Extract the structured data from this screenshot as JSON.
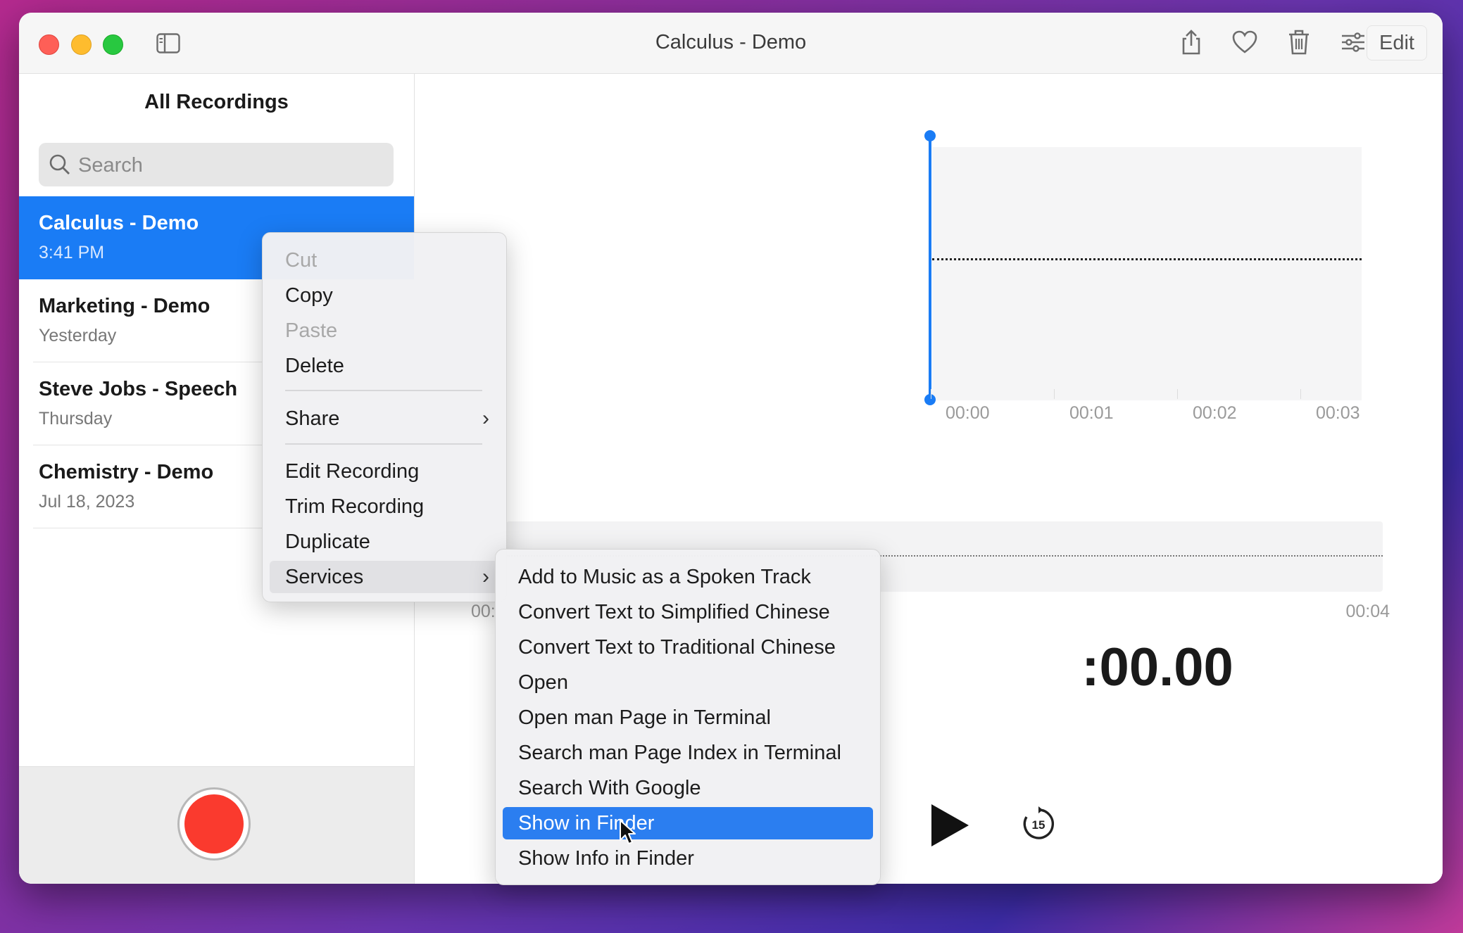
{
  "window": {
    "title": "Calculus - Demo"
  },
  "toolbar": {
    "edit_label": "Edit",
    "icons": [
      "sidebar-toggle-icon",
      "share-icon",
      "heart-icon",
      "trash-icon",
      "sliders-icon"
    ]
  },
  "sidebar": {
    "title": "All Recordings",
    "search": {
      "placeholder": "Search",
      "value": ""
    },
    "recordings": [
      {
        "name": "Calculus - Demo",
        "date": "3:41 PM",
        "selected": true
      },
      {
        "name": "Marketing - Demo",
        "date": "Yesterday"
      },
      {
        "name": "Steve Jobs - Speech",
        "date": "Thursday"
      },
      {
        "name": "Chemistry - Demo",
        "date": "Jul 18, 2023"
      }
    ]
  },
  "editor": {
    "ticks": [
      "00:00",
      "00:01",
      "00:02",
      "00:03"
    ],
    "overview_start": "00:",
    "overview_end": "00:04",
    "timer": ":00.00",
    "skip_seconds": "15"
  },
  "context_menu": {
    "cut": "Cut",
    "copy": "Copy",
    "paste": "Paste",
    "delete": "Delete",
    "share": "Share",
    "edit_recording": "Edit Recording",
    "trim_recording": "Trim Recording",
    "duplicate": "Duplicate",
    "services": "Services"
  },
  "services_menu": [
    "Add to Music as a Spoken Track",
    "Convert Text to Simplified Chinese",
    "Convert Text to Traditional Chinese",
    "Open",
    "Open man Page in Terminal",
    "Search man Page Index in Terminal",
    "Search With Google",
    "Show in Finder",
    "Show Info in Finder"
  ],
  "colors": {
    "accent": "#1a7cf5",
    "record": "#fa3a2e",
    "menu_highlight": "#2b7ef0"
  }
}
